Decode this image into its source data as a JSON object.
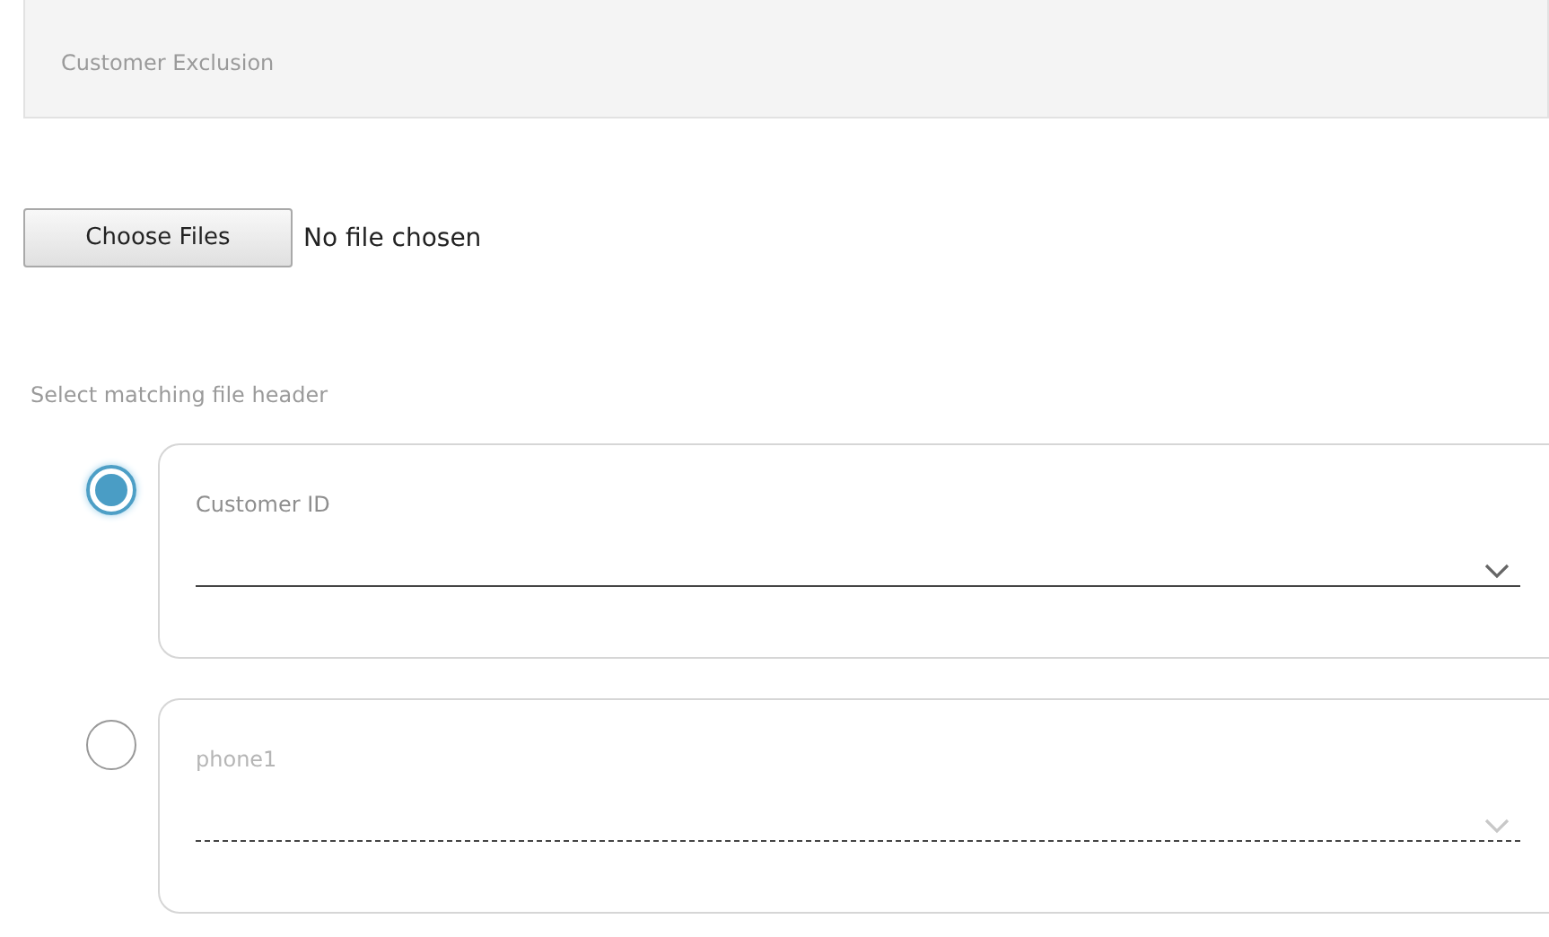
{
  "panel": {
    "title": "Customer Exclusion"
  },
  "file_input": {
    "button": "Choose Files",
    "status": "No file chosen"
  },
  "section_label": "Select matching file header",
  "options": [
    {
      "label": "Customer ID",
      "selected": true,
      "disabled": false
    },
    {
      "label": "phone1",
      "selected": false,
      "disabled": true
    }
  ]
}
